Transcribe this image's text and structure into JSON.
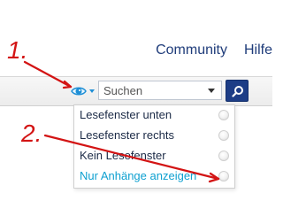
{
  "header": {
    "nav": [
      {
        "label": "Community"
      },
      {
        "label": "Hilfe"
      }
    ]
  },
  "toolbar": {
    "search": {
      "placeholder": "Suchen"
    }
  },
  "menu": {
    "items": [
      {
        "label": "Lesefenster unten",
        "selected": false
      },
      {
        "label": "Lesefenster rechts",
        "selected": false
      },
      {
        "label": "Kein Lesefenster",
        "selected": false
      },
      {
        "label": "Nur Anhänge anzeigen",
        "selected": false,
        "active": true
      }
    ]
  },
  "annotations": {
    "marker_1": "1.",
    "marker_2": "2."
  },
  "colors": {
    "nav_text": "#1f3c7a",
    "eye_icon": "#1e8fd6",
    "search_button": "#1d3d86",
    "menu_active": "#0ea0d0",
    "annotation": "#d31414"
  }
}
